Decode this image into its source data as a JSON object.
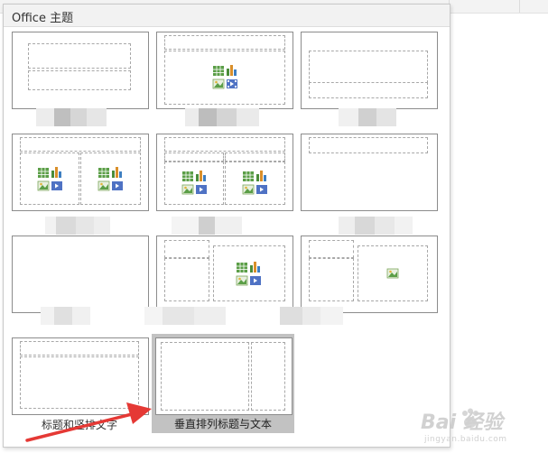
{
  "panel": {
    "title": "Office 主题"
  },
  "layouts": [
    {
      "id": "title-slide",
      "caption": ""
    },
    {
      "id": "title-and-content",
      "caption": ""
    },
    {
      "id": "section-header",
      "caption": ""
    },
    {
      "id": "two-content",
      "caption": ""
    },
    {
      "id": "comparison",
      "caption": ""
    },
    {
      "id": "title-only",
      "caption": ""
    },
    {
      "id": "blank",
      "caption": ""
    },
    {
      "id": "content-with-caption",
      "caption": ""
    },
    {
      "id": "picture-with-caption",
      "caption": ""
    },
    {
      "id": "title-and-vertical-text",
      "caption": "标题和竖排文字"
    },
    {
      "id": "vertical-title-and-text",
      "caption": "垂直排列标题与文本",
      "selected": true
    }
  ],
  "watermark": {
    "text": "Bai 经验",
    "sub": "jingyan.baidu.com"
  },
  "colors": {
    "arrow": "#e53935",
    "selected": "#c2c2c2",
    "tile_border": "#8c8c8c"
  },
  "icons": {
    "table": "table-icon",
    "chart": "chart-icon",
    "picture": "picture-icon",
    "media": "media-icon"
  }
}
